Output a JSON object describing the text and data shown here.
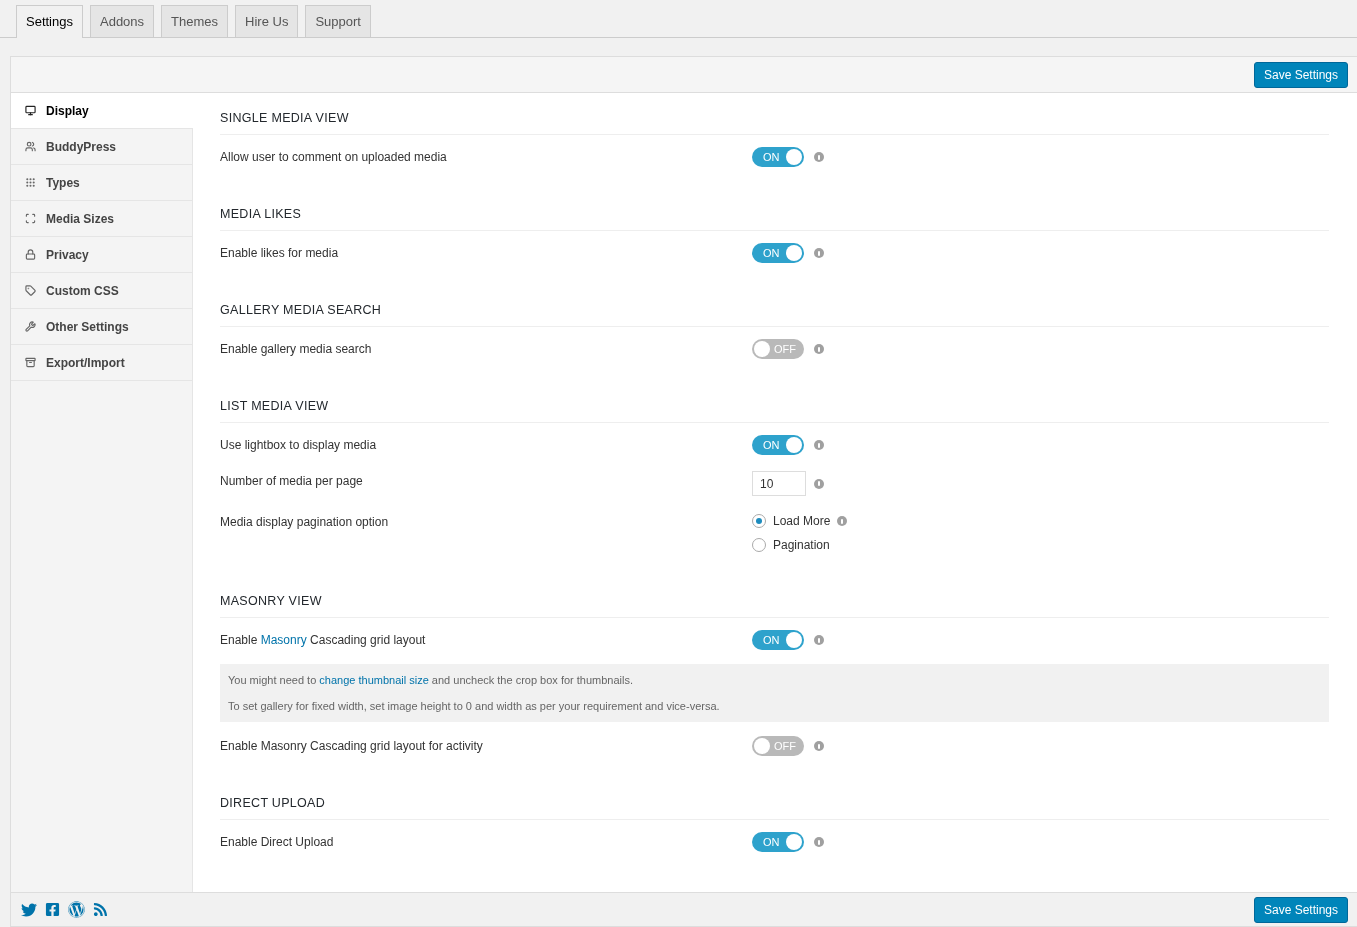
{
  "tabs": [
    {
      "label": "Settings",
      "selected": true
    },
    {
      "label": "Addons",
      "selected": false
    },
    {
      "label": "Themes",
      "selected": false
    },
    {
      "label": "Hire Us",
      "selected": false
    },
    {
      "label": "Support",
      "selected": false
    }
  ],
  "save_button_top": "Save Settings",
  "sidebar": {
    "items": [
      {
        "label": "Display",
        "selected": true
      },
      {
        "label": "BuddyPress",
        "selected": false
      },
      {
        "label": "Types",
        "selected": false
      },
      {
        "label": "Media Sizes",
        "selected": false
      },
      {
        "label": "Privacy",
        "selected": false
      },
      {
        "label": "Custom CSS",
        "selected": false
      },
      {
        "label": "Other Settings",
        "selected": false
      },
      {
        "label": "Export/Import",
        "selected": false
      }
    ]
  },
  "sections": [
    {
      "title": "SINGLE MEDIA VIEW",
      "rows": [
        {
          "kind": "toggle",
          "label": [
            {
              "text": "Allow user to comment on uploaded media"
            }
          ],
          "on": true,
          "toggle_text": "ON"
        }
      ]
    },
    {
      "title": "MEDIA LIKES",
      "rows": [
        {
          "kind": "toggle",
          "label": [
            {
              "text": "Enable likes for media"
            }
          ],
          "on": true,
          "toggle_text": "ON"
        }
      ]
    },
    {
      "title": "GALLERY MEDIA SEARCH",
      "rows": [
        {
          "kind": "toggle",
          "label": [
            {
              "text": "Enable gallery media search"
            }
          ],
          "on": false,
          "toggle_text": "OFF"
        }
      ]
    },
    {
      "title": "LIST MEDIA VIEW",
      "rows": [
        {
          "kind": "toggle",
          "label": [
            {
              "text": "Use lightbox to display media"
            }
          ],
          "on": true,
          "toggle_text": "ON"
        },
        {
          "kind": "number",
          "label": [
            {
              "text": "Number of media per page"
            }
          ],
          "value": "10"
        },
        {
          "kind": "radio",
          "label": [
            {
              "text": "Media display pagination option"
            }
          ],
          "options": [
            {
              "label": "Load More",
              "selected": true
            },
            {
              "label": "Pagination",
              "selected": false
            }
          ]
        }
      ]
    },
    {
      "title": "MASONRY VIEW",
      "rows": [
        {
          "kind": "toggle",
          "label": [
            {
              "text": "Enable "
            },
            {
              "text": "Masonry",
              "link": true
            },
            {
              "text": " Cascading grid layout"
            }
          ],
          "on": true,
          "toggle_text": "ON"
        },
        {
          "kind": "notice",
          "paragraphs": [
            [
              {
                "text": "You might need to "
              },
              {
                "text": "change thumbnail size",
                "link": true
              },
              {
                "text": " and uncheck the crop box for thumbnails."
              }
            ],
            [
              {
                "text": "To set gallery for fixed width, set image height to 0 and width as per your requirement and vice-versa."
              }
            ]
          ]
        },
        {
          "kind": "toggle",
          "label": [
            {
              "text": "Enable Masonry Cascading grid layout for activity"
            }
          ],
          "on": false,
          "toggle_text": "OFF"
        }
      ]
    },
    {
      "title": "DIRECT UPLOAD",
      "rows": [
        {
          "kind": "toggle",
          "label": [
            {
              "text": "Enable Direct Upload"
            }
          ],
          "on": true,
          "toggle_text": "ON"
        }
      ]
    }
  ],
  "save_button_bottom": "Save Settings"
}
